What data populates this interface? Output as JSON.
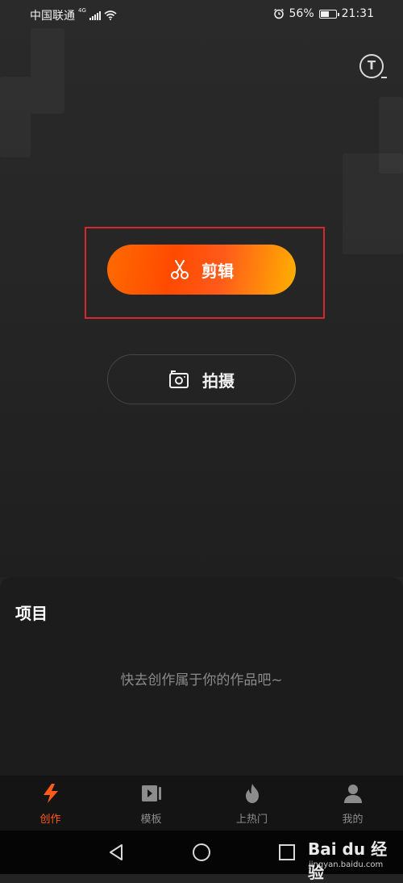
{
  "status_bar": {
    "carrier": "中国联通",
    "network": "4G",
    "battery": "56%",
    "battery_level": 0.56,
    "time": "21:31",
    "icons": [
      "signal-icon",
      "wifi-icon",
      "alarm-icon",
      "battery-icon"
    ]
  },
  "top": {
    "text_tool_icon": "T"
  },
  "actions": {
    "edit_label": "剪辑",
    "edit_icon": "scissors-icon",
    "shoot_label": "拍摄",
    "shoot_icon": "camera-icon"
  },
  "projects": {
    "title": "项目",
    "empty_text": "快去创作属于你的作品吧~"
  },
  "tabs": [
    {
      "label": "创作",
      "icon": "lightning-icon",
      "active": true
    },
    {
      "label": "模板",
      "icon": "video-template-icon",
      "active": false
    },
    {
      "label": "上热门",
      "icon": "flame-icon",
      "active": false
    },
    {
      "label": "我的",
      "icon": "person-icon",
      "active": false
    }
  ],
  "system_nav": [
    "back-icon",
    "home-icon",
    "recents-icon"
  ],
  "watermark": {
    "brand": "Bai du 经验",
    "site": "jingyan.baidu.com"
  },
  "colors": {
    "accent": "#ff5a1a",
    "highlight_box": "#d7262e",
    "background": "#232323"
  }
}
